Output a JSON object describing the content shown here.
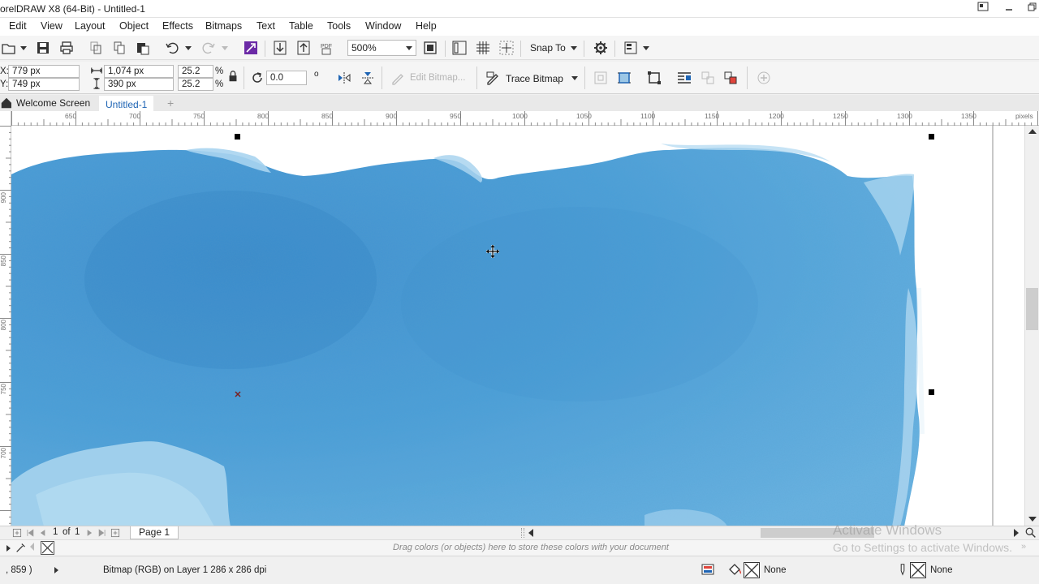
{
  "window": {
    "title": "orelDRAW X8 (64-Bit) - Untitled-1"
  },
  "menu": [
    "Edit",
    "View",
    "Layout",
    "Object",
    "Effects",
    "Bitmaps",
    "Text",
    "Table",
    "Tools",
    "Window",
    "Help"
  ],
  "toolbar": {
    "zoom_value": "500%",
    "snap_to_label": "Snap To"
  },
  "propertybar": {
    "x_value": "779 px",
    "y_value": "749 px",
    "x_label": "X:",
    "y_label": "Y:",
    "width_value": "1,074 px",
    "height_value": "390 px",
    "scale_x": "25.2",
    "scale_y": "25.2",
    "percent": "%",
    "rotation": "0.0",
    "degree_symbol": "o",
    "edit_bitmap_label": "Edit Bitmap...",
    "trace_bitmap_label": "Trace Bitmap"
  },
  "tabs": {
    "welcome": "Welcome Screen",
    "document": "Untitled-1",
    "add": "+"
  },
  "ruler": {
    "h_ticks": [
      "650",
      "700",
      "750",
      "800",
      "850",
      "900",
      "950",
      "1000",
      "1050",
      "1100",
      "1150",
      "1200",
      "1250",
      "1300",
      "1350"
    ],
    "unit": "pixels",
    "v_ticks": [
      "900",
      "850",
      "800",
      "750",
      "700"
    ]
  },
  "pagebar": {
    "current": "1",
    "of": "of",
    "total": "1",
    "page_tab": "Page 1"
  },
  "palette": {
    "hint": "Drag colors (or objects) here to store these colors with your document"
  },
  "watermark": {
    "line1": "Activate Windows",
    "line2": "Go to Settings to activate Windows."
  },
  "status": {
    "coords": ", 859  )",
    "info": "Bitmap (RGB) on Layer 1 286 x 286 dpi",
    "fill_label": "None",
    "outline_label": "None"
  },
  "colors": {
    "watercolor": "#4a9fd6",
    "watercolor_light": "#a9d4ef",
    "accent": "#1e64b4"
  }
}
